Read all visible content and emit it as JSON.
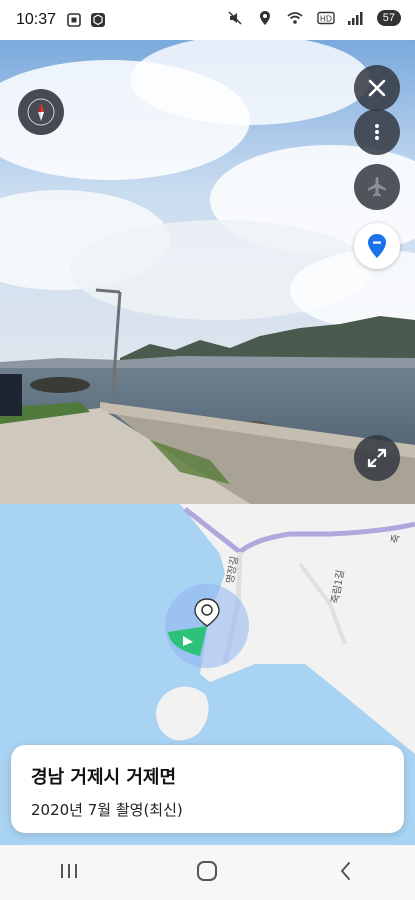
{
  "status_bar": {
    "time": "10:37",
    "battery": "57",
    "icons": [
      "screenshot-icon",
      "cube-icon",
      "mute-icon",
      "location-icon",
      "wifi-icon",
      "hd-icon",
      "signal-icon"
    ]
  },
  "street_view": {
    "buttons": [
      "compass-icon",
      "close-icon",
      "more-vert-icon",
      "airplane-icon",
      "location-pin-icon",
      "expand-icon"
    ]
  },
  "map": {
    "road_labels": [
      "명장길",
      "죽림1길",
      "죽"
    ]
  },
  "info_card": {
    "title": "경남 거제시 거제면",
    "subtitle": "2020년 7월 촬영(최신)"
  },
  "navigation": {
    "items": [
      "recents-icon",
      "home-icon",
      "back-icon"
    ]
  },
  "colors": {
    "water": "#a8d3f2",
    "land": "#f2f2f2",
    "route": "#b0a8dc",
    "pin": "#1a73e8"
  }
}
